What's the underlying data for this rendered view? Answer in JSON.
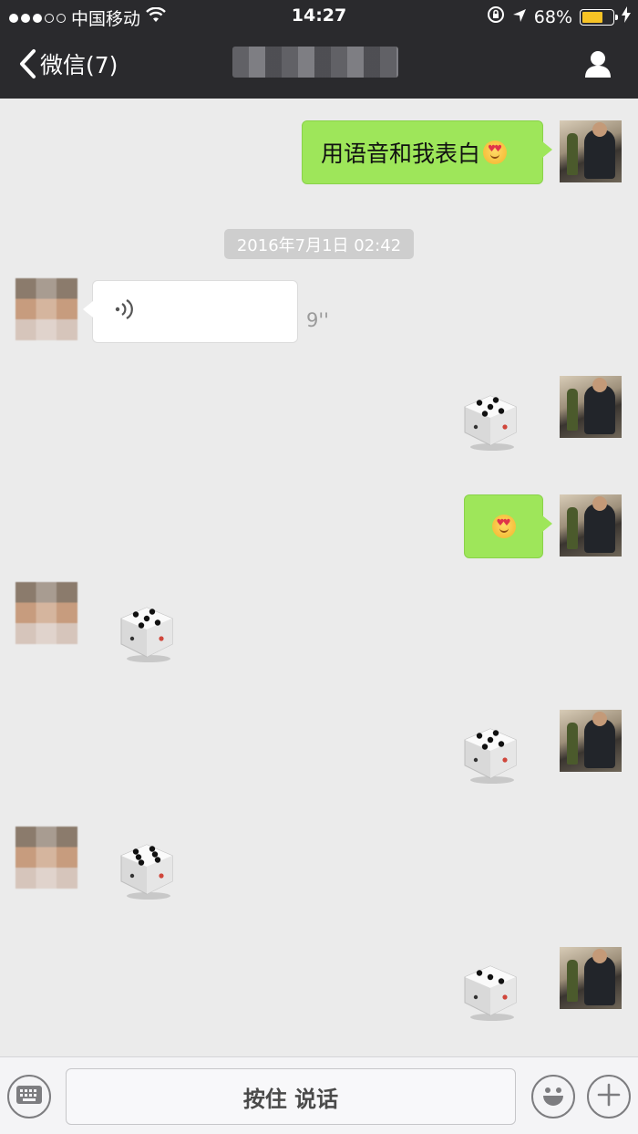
{
  "status_bar": {
    "carrier": "中国移动",
    "time": "14:27",
    "battery_percent": "68%",
    "battery_level": 0.68,
    "battery_color": "#f7c325"
  },
  "nav": {
    "back_label": "微信(7)",
    "back_icon": "chevron-left-icon",
    "contact_icon": "person-icon"
  },
  "chat": {
    "timestamp": "2016年7月1日 02:42",
    "messages": [
      {
        "from": "me",
        "type": "text",
        "text": "用语音和我表白",
        "emoji": "heart-eyes-emoji"
      },
      {
        "from": "other",
        "type": "voice",
        "duration": "9''"
      },
      {
        "from": "me",
        "type": "dice",
        "value": 5
      },
      {
        "from": "me",
        "type": "emoji",
        "emoji": "heart-eyes-emoji"
      },
      {
        "from": "other",
        "type": "dice",
        "value": 5
      },
      {
        "from": "me",
        "type": "dice",
        "value": 5
      },
      {
        "from": "other",
        "type": "dice",
        "value": 6
      },
      {
        "from": "me",
        "type": "dice",
        "value": 3
      }
    ]
  },
  "toolbar": {
    "talk_label": "按住 说话",
    "keyboard_icon": "keyboard-icon",
    "emoji_icon": "smiley-icon",
    "plus_icon": "plus-icon"
  },
  "colors": {
    "bar_bg": "#2a2a2d",
    "chat_bg": "#ebebeb",
    "my_bubble": "#9ee65a"
  }
}
